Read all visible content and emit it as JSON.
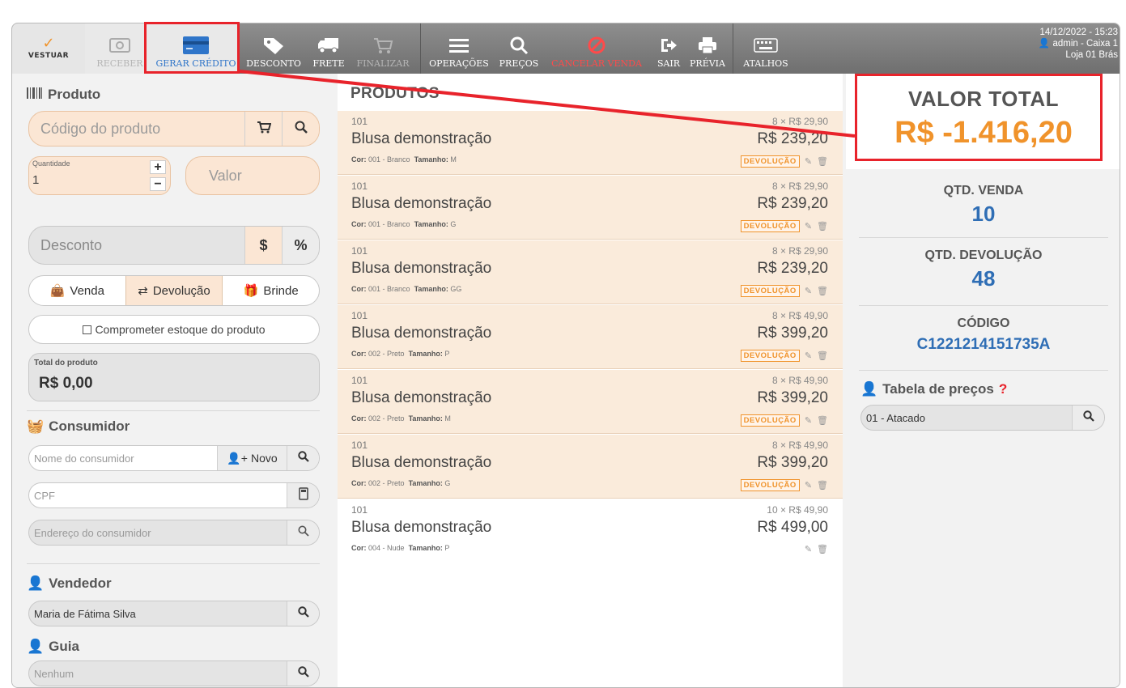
{
  "toolbar": {
    "brand": "VESTUAR",
    "buttons": {
      "receber": "RECEBER",
      "gerar_credito": "GERAR CRÉDITO",
      "desconto": "DESCONTO",
      "frete": "FRETE",
      "finalizar": "FINALIZAR",
      "operacoes": "OPERAÇÕES",
      "precos": "PREÇOS",
      "cancelar_venda": "CANCELAR VENDA",
      "sair": "SAIR",
      "previa": "PRÉVIA",
      "atalhos": "ATALHOS"
    },
    "datetime": "14/12/2022 - 15:23",
    "user": "admin - Caixa 1",
    "store": "Loja 01 Brás"
  },
  "left": {
    "produto_title": "Produto",
    "codigo_placeholder": "Código do produto",
    "quantidade_label": "Quantidade",
    "quantidade_value": "1",
    "valor_placeholder": "Valor",
    "desconto_placeholder": "Desconto",
    "desconto_currency": "$",
    "desconto_percent": "%",
    "modes": [
      "Venda",
      "Devolução",
      "Brinde"
    ],
    "comprometer": "Comprometer estoque do produto",
    "total_label": "Total do produto",
    "total_value": "R$ 0,00",
    "consumidor_title": "Consumidor",
    "consumidor_placeholder": "Nome do consumidor",
    "novo_label": "Novo",
    "cpf_placeholder": "CPF",
    "endereco_placeholder": "Endereço do consumidor",
    "vendedor_title": "Vendedor",
    "vendedor_value": "Maria de Fátima Silva",
    "guia_title": "Guia",
    "guia_placeholder": "Nenhum"
  },
  "middle": {
    "title": "PRODUTOS",
    "attr_cor_label": "Cor:",
    "attr_tamanho_label": "Tamanho:",
    "items": [
      {
        "code": "101",
        "name": "Blusa demonstração",
        "cor": "001 - Branco",
        "tamanho": "M",
        "qty": "8 × R$ 29,90",
        "total": "R$ 239,20",
        "badge": "DEVOLUÇÃO"
      },
      {
        "code": "101",
        "name": "Blusa demonstração",
        "cor": "001 - Branco",
        "tamanho": "G",
        "qty": "8 × R$ 29,90",
        "total": "R$ 239,20",
        "badge": "DEVOLUÇÃO"
      },
      {
        "code": "101",
        "name": "Blusa demonstração",
        "cor": "001 - Branco",
        "tamanho": "GG",
        "qty": "8 × R$ 29,90",
        "total": "R$ 239,20",
        "badge": "DEVOLUÇÃO"
      },
      {
        "code": "101",
        "name": "Blusa demonstração",
        "cor": "002 - Preto",
        "tamanho": "P",
        "qty": "8 × R$ 49,90",
        "total": "R$ 399,20",
        "badge": "DEVOLUÇÃO"
      },
      {
        "code": "101",
        "name": "Blusa demonstração",
        "cor": "002 - Preto",
        "tamanho": "M",
        "qty": "8 × R$ 49,90",
        "total": "R$ 399,20",
        "badge": "DEVOLUÇÃO"
      },
      {
        "code": "101",
        "name": "Blusa demonstração",
        "cor": "002 - Preto",
        "tamanho": "G",
        "qty": "8 × R$ 49,90",
        "total": "R$ 399,20",
        "badge": "DEVOLUÇÃO"
      },
      {
        "code": "101",
        "name": "Blusa demonstração",
        "cor": "004 - Nude",
        "tamanho": "P",
        "qty": "10 × R$ 49,90",
        "total": "R$ 499,00",
        "badge": ""
      }
    ]
  },
  "right": {
    "valor_total_label": "VALOR TOTAL",
    "valor_total_value": "R$ -1.416,20",
    "qtd_venda_label": "QTD. VENDA",
    "qtd_venda_value": "10",
    "qtd_devolucao_label": "QTD. DEVOLUÇÃO",
    "qtd_devolucao_value": "48",
    "codigo_label": "CÓDIGO",
    "codigo_value": "C1221214151735A",
    "tabela_title": "Tabela de preços",
    "tabela_help": "?",
    "tabela_value": "01 - Atacado"
  },
  "colors": {
    "accent_orange": "#f0932b",
    "accent_blue": "#2f6eb5",
    "highlight_red": "#e8232b",
    "row_orange": "#faebdb"
  }
}
